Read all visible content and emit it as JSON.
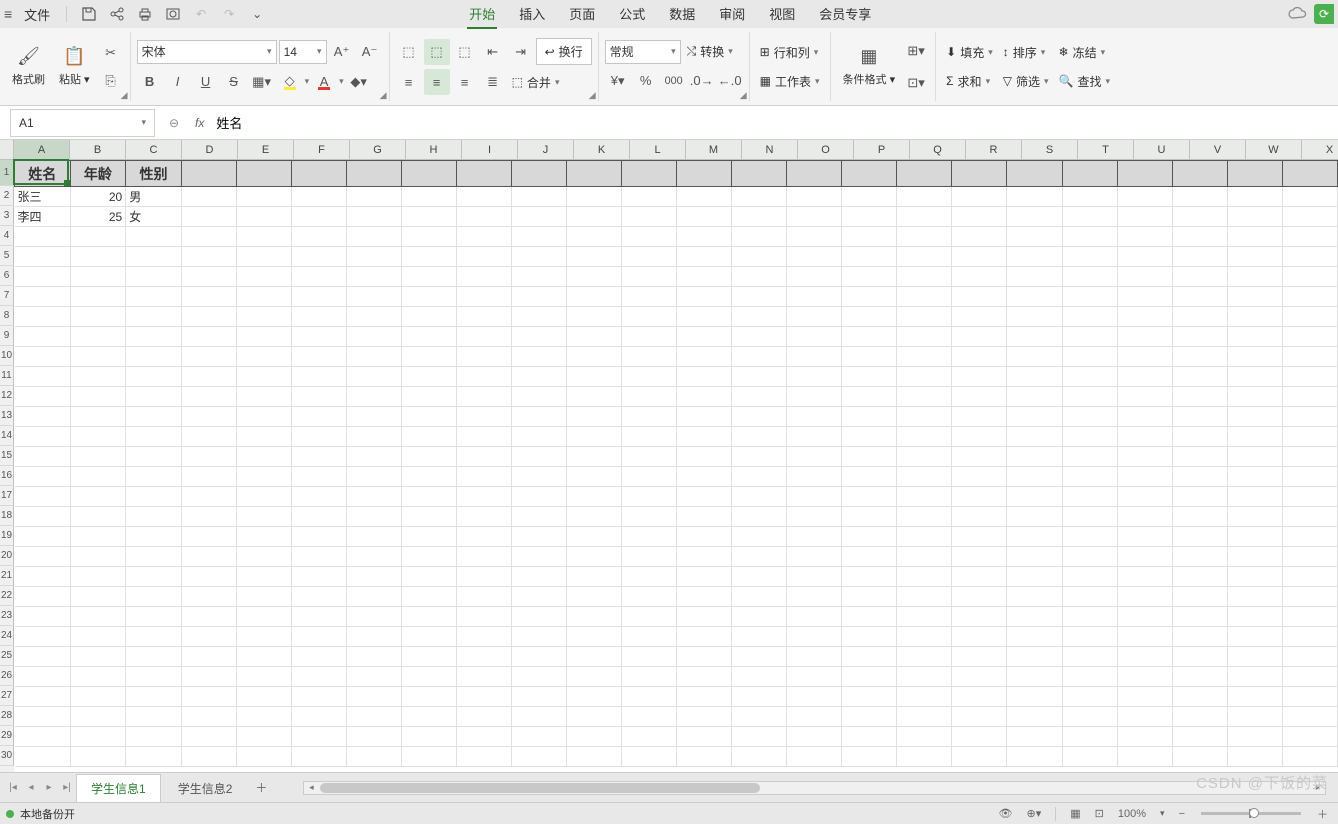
{
  "titlebar": {
    "file_label": "文件",
    "tabs": [
      "开始",
      "插入",
      "页面",
      "公式",
      "数据",
      "审阅",
      "视图",
      "会员专享"
    ],
    "active_tab": 0
  },
  "qat": {
    "save": "save-icon",
    "share": "share-icon",
    "print": "print-icon",
    "preview": "preview-icon",
    "undo": "undo-icon",
    "redo": "redo-icon",
    "more": "more-icon"
  },
  "ribbon": {
    "format_painter": "格式刷",
    "paste": "粘贴",
    "font_name": "宋体",
    "font_size": "14",
    "number_format": "常规",
    "wrap": "换行",
    "merge": "合并",
    "convert": "转换",
    "rows_cols": "行和列",
    "worksheet": "工作表",
    "cond_fmt": "条件格式",
    "fill": "填充",
    "sort": "排序",
    "freeze": "冻结",
    "sum": "求和",
    "filter": "筛选",
    "find": "查找"
  },
  "formula_bar": {
    "cell_ref": "A1",
    "formula": "姓名"
  },
  "columns": [
    "A",
    "B",
    "C",
    "D",
    "E",
    "F",
    "G",
    "H",
    "I",
    "J",
    "K",
    "L",
    "M",
    "N",
    "O",
    "P",
    "Q",
    "R",
    "S",
    "T",
    "U",
    "V",
    "W",
    "X"
  ],
  "active_cell": {
    "col": "A",
    "row": 1
  },
  "sheet_data": {
    "headers": [
      "姓名",
      "年龄",
      "性别"
    ],
    "rows": [
      {
        "name": "张三",
        "age": "20",
        "gender": "男"
      },
      {
        "name": "李四",
        "age": "25",
        "gender": "女"
      }
    ]
  },
  "sheets": {
    "tabs": [
      "学生信息1",
      "学生信息2"
    ],
    "active": 0
  },
  "status": {
    "backup": "本地备份开",
    "zoom": "100%"
  },
  "watermark": "CSDN @下饭的菜",
  "row_count": 30
}
